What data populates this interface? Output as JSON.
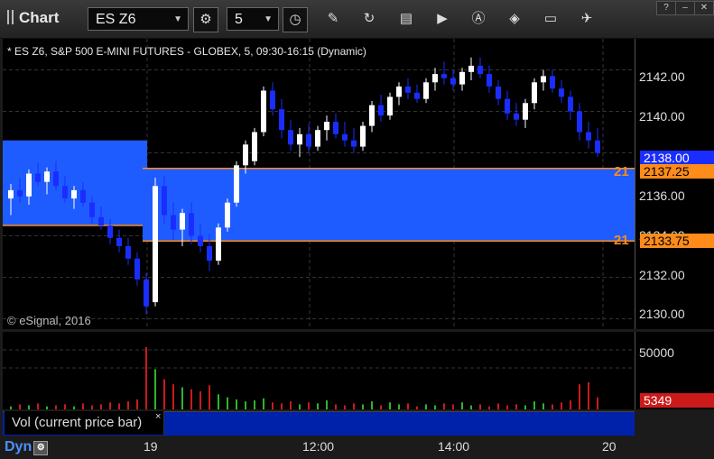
{
  "toolbar": {
    "app_title": "Chart",
    "symbol": "ES Z6",
    "interval": "5"
  },
  "chart": {
    "header": "* ES Z6, S&P 500 E-MINI FUTURES - GLOBEX, 5, 09:30-16:15 (Dynamic)",
    "copyright": "© eSignal, 2016",
    "price_ticks": [
      "2142.00",
      "2140.00",
      "2138.00",
      "2136.00",
      "2134.00",
      "2132.00",
      "2130.00"
    ],
    "last_price_tag": "2138.00",
    "level_upper_tag": "2137.25",
    "level_lower_tag": "2133.75",
    "level_upper_left": "21",
    "level_lower_left": "21",
    "colors": {
      "up": "#ffffff",
      "down": "#1a2dff",
      "zone": "#1f5cff",
      "level": "#ff8c1a",
      "vol_up": "#2db52d",
      "vol_down": "#cc1a1a"
    }
  },
  "volume": {
    "label": "Vol (current price bar)",
    "close_glyph": "×",
    "tick": "50000",
    "current_tag": "5349"
  },
  "time_axis": {
    "mode": "Dyn",
    "ticks": [
      "19",
      "12:00",
      "14:00",
      "20"
    ]
  },
  "chart_data": {
    "type": "candlestick",
    "ylim": [
      2129.5,
      2143.5
    ],
    "upper_level": 2137.25,
    "lower_level": 2133.75,
    "last": 2138.0,
    "candles": [
      [
        2135.8,
        2136.5,
        2135.0,
        2136.2
      ],
      [
        2136.2,
        2136.8,
        2135.6,
        2135.9
      ],
      [
        2135.9,
        2137.2,
        2135.5,
        2137.0
      ],
      [
        2137.0,
        2137.5,
        2136.4,
        2136.6
      ],
      [
        2136.6,
        2137.3,
        2136.0,
        2137.1
      ],
      [
        2137.1,
        2137.6,
        2136.2,
        2136.4
      ],
      [
        2136.4,
        2136.9,
        2135.6,
        2135.8
      ],
      [
        2135.8,
        2136.4,
        2135.3,
        2136.2
      ],
      [
        2136.2,
        2136.6,
        2135.4,
        2135.6
      ],
      [
        2135.6,
        2135.9,
        2134.6,
        2134.9
      ],
      [
        2134.9,
        2135.4,
        2134.3,
        2134.5
      ],
      [
        2134.5,
        2134.8,
        2133.6,
        2133.9
      ],
      [
        2133.9,
        2134.3,
        2133.2,
        2133.5
      ],
      [
        2133.5,
        2133.9,
        2132.6,
        2132.9
      ],
      [
        2132.9,
        2133.2,
        2131.6,
        2131.9
      ],
      [
        2131.9,
        2132.2,
        2130.2,
        2130.6
      ],
      [
        2130.8,
        2136.8,
        2130.6,
        2136.4
      ],
      [
        2136.4,
        2136.9,
        2134.6,
        2135.0
      ],
      [
        2135.0,
        2135.6,
        2133.8,
        2134.3
      ],
      [
        2134.3,
        2135.3,
        2133.5,
        2135.1
      ],
      [
        2135.1,
        2135.6,
        2133.6,
        2134.0
      ],
      [
        2134.0,
        2134.6,
        2133.2,
        2133.5
      ],
      [
        2133.5,
        2134.1,
        2132.3,
        2132.8
      ],
      [
        2132.8,
        2134.6,
        2132.6,
        2134.4
      ],
      [
        2134.4,
        2135.8,
        2134.2,
        2135.6
      ],
      [
        2135.6,
        2137.6,
        2135.4,
        2137.4
      ],
      [
        2137.4,
        2138.6,
        2137.0,
        2138.4
      ],
      [
        2137.6,
        2139.2,
        2137.4,
        2139.0
      ],
      [
        2139.0,
        2141.2,
        2138.8,
        2141.0
      ],
      [
        2141.0,
        2141.4,
        2139.8,
        2140.1
      ],
      [
        2140.1,
        2140.6,
        2138.7,
        2139.1
      ],
      [
        2139.1,
        2139.6,
        2138.1,
        2138.4
      ],
      [
        2138.4,
        2139.2,
        2137.8,
        2138.9
      ],
      [
        2138.9,
        2139.4,
        2138.0,
        2138.3
      ],
      [
        2138.3,
        2139.3,
        2138.1,
        2139.1
      ],
      [
        2139.1,
        2139.8,
        2138.6,
        2139.5
      ],
      [
        2139.5,
        2139.9,
        2138.7,
        2138.9
      ],
      [
        2138.9,
        2139.5,
        2138.3,
        2138.6
      ],
      [
        2138.6,
        2139.2,
        2138.0,
        2138.3
      ],
      [
        2138.3,
        2139.5,
        2138.1,
        2139.3
      ],
      [
        2139.3,
        2140.5,
        2139.0,
        2140.3
      ],
      [
        2140.3,
        2140.8,
        2139.5,
        2139.8
      ],
      [
        2139.8,
        2140.9,
        2139.6,
        2140.7
      ],
      [
        2140.7,
        2141.4,
        2140.3,
        2141.2
      ],
      [
        2141.2,
        2141.6,
        2140.6,
        2140.9
      ],
      [
        2140.9,
        2141.3,
        2140.4,
        2140.6
      ],
      [
        2140.6,
        2141.6,
        2140.4,
        2141.4
      ],
      [
        2141.4,
        2142.1,
        2141.0,
        2141.8
      ],
      [
        2141.8,
        2142.4,
        2141.3,
        2141.6
      ],
      [
        2141.6,
        2142.0,
        2141.0,
        2141.3
      ],
      [
        2141.3,
        2142.1,
        2141.0,
        2141.9
      ],
      [
        2141.9,
        2142.6,
        2141.5,
        2142.2
      ],
      [
        2142.2,
        2142.6,
        2141.6,
        2141.8
      ],
      [
        2141.8,
        2142.2,
        2140.9,
        2141.2
      ],
      [
        2141.2,
        2141.5,
        2140.3,
        2140.6
      ],
      [
        2140.6,
        2141.0,
        2139.6,
        2139.9
      ],
      [
        2139.9,
        2140.4,
        2139.3,
        2139.6
      ],
      [
        2139.6,
        2140.6,
        2139.2,
        2140.4
      ],
      [
        2140.4,
        2141.6,
        2140.1,
        2141.4
      ],
      [
        2141.4,
        2142.0,
        2141.0,
        2141.7
      ],
      [
        2141.7,
        2142.0,
        2140.9,
        2141.1
      ],
      [
        2141.1,
        2141.5,
        2140.4,
        2140.7
      ],
      [
        2140.7,
        2141.0,
        2139.6,
        2140.0
      ],
      [
        2140.0,
        2140.4,
        2138.6,
        2139.0
      ],
      [
        2139.0,
        2139.5,
        2138.2,
        2138.6
      ],
      [
        2138.6,
        2139.2,
        2137.8,
        2138.0
      ]
    ],
    "volumes": [
      3,
      5,
      4,
      6,
      3,
      4,
      5,
      3,
      6,
      4,
      5,
      7,
      6,
      8,
      10,
      62,
      40,
      30,
      25,
      22,
      20,
      18,
      24,
      15,
      12,
      10,
      8,
      9,
      11,
      7,
      6,
      8,
      5,
      7,
      6,
      9,
      5,
      4,
      6,
      5,
      8,
      4,
      7,
      5,
      6,
      3,
      5,
      4,
      6,
      5,
      7,
      4,
      5,
      3,
      6,
      4,
      5,
      4,
      8,
      6,
      5,
      7,
      9,
      25,
      27,
      12
    ]
  }
}
